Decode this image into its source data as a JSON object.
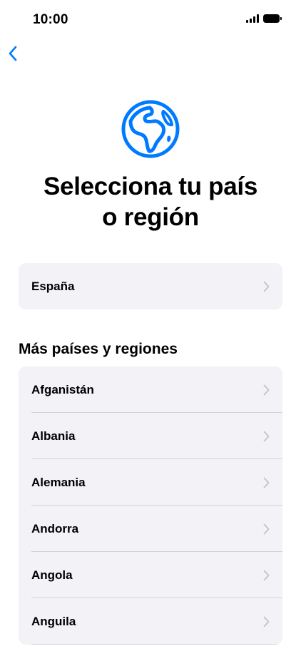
{
  "status_bar": {
    "time": "10:00",
    "icons": [
      "cellular-signal-icon",
      "battery-icon"
    ]
  },
  "nav": {
    "back_icon": "chevron-left-icon"
  },
  "header": {
    "icon": "globe-icon",
    "title_line1": "Selecciona tu país",
    "title_line2": "o región"
  },
  "current_region": {
    "label": "España"
  },
  "more_regions": {
    "header": "Más países y regiones",
    "items": [
      {
        "label": "Afganistán"
      },
      {
        "label": "Albania"
      },
      {
        "label": "Alemania"
      },
      {
        "label": "Andorra"
      },
      {
        "label": "Angola"
      },
      {
        "label": "Anguila"
      }
    ]
  },
  "colors": {
    "accent": "#007aff",
    "group_background": "#f2f2f7",
    "separator": "#d1d1d6",
    "chevron": "#c4c4c7"
  }
}
